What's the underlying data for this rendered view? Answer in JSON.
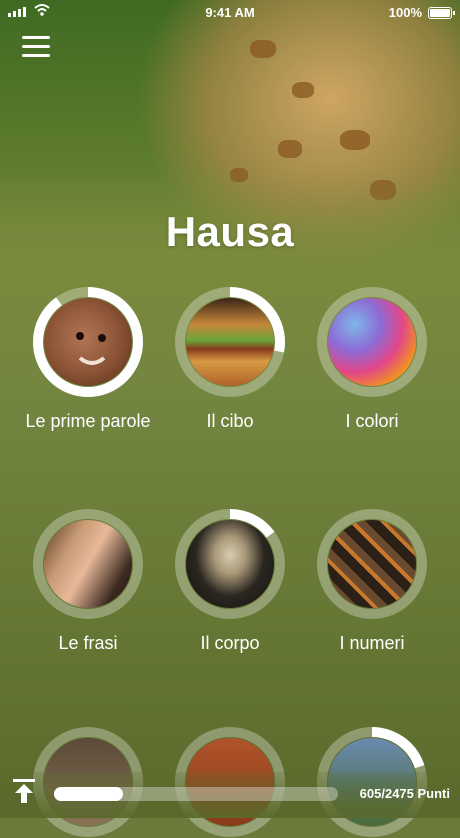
{
  "status_bar": {
    "time": "9:41 AM",
    "battery": "100%"
  },
  "header": {
    "menu_icon": "hamburger-menu-icon",
    "title": "Hausa"
  },
  "topics": [
    {
      "label": "Le prime parole",
      "progress": 0.9,
      "image": "smiling-baby"
    },
    {
      "label": "Il cibo",
      "progress": 0.28,
      "image": "burger-and-fries"
    },
    {
      "label": "I colori",
      "progress": 0,
      "image": "colored-powder"
    },
    {
      "label": "Le frasi",
      "progress": 0,
      "image": "smiling-woman"
    },
    {
      "label": "Il corpo",
      "progress": 0.15,
      "image": "skeleton"
    },
    {
      "label": "I numeri",
      "progress": 0,
      "image": "wooden-digits"
    },
    {
      "label": "",
      "progress": 0,
      "image": "animal"
    },
    {
      "label": "",
      "progress": 0,
      "image": "terracotta"
    },
    {
      "label": "",
      "progress": 0.2,
      "image": "landscape"
    }
  ],
  "footer": {
    "upload_icon": "upload-arrow-icon",
    "progress": 0.244,
    "points_text": "605/2475 Punti"
  },
  "colors": {
    "ring_track": "rgba(255,255,255,0.3)",
    "ring_progress": "#ffffff"
  }
}
